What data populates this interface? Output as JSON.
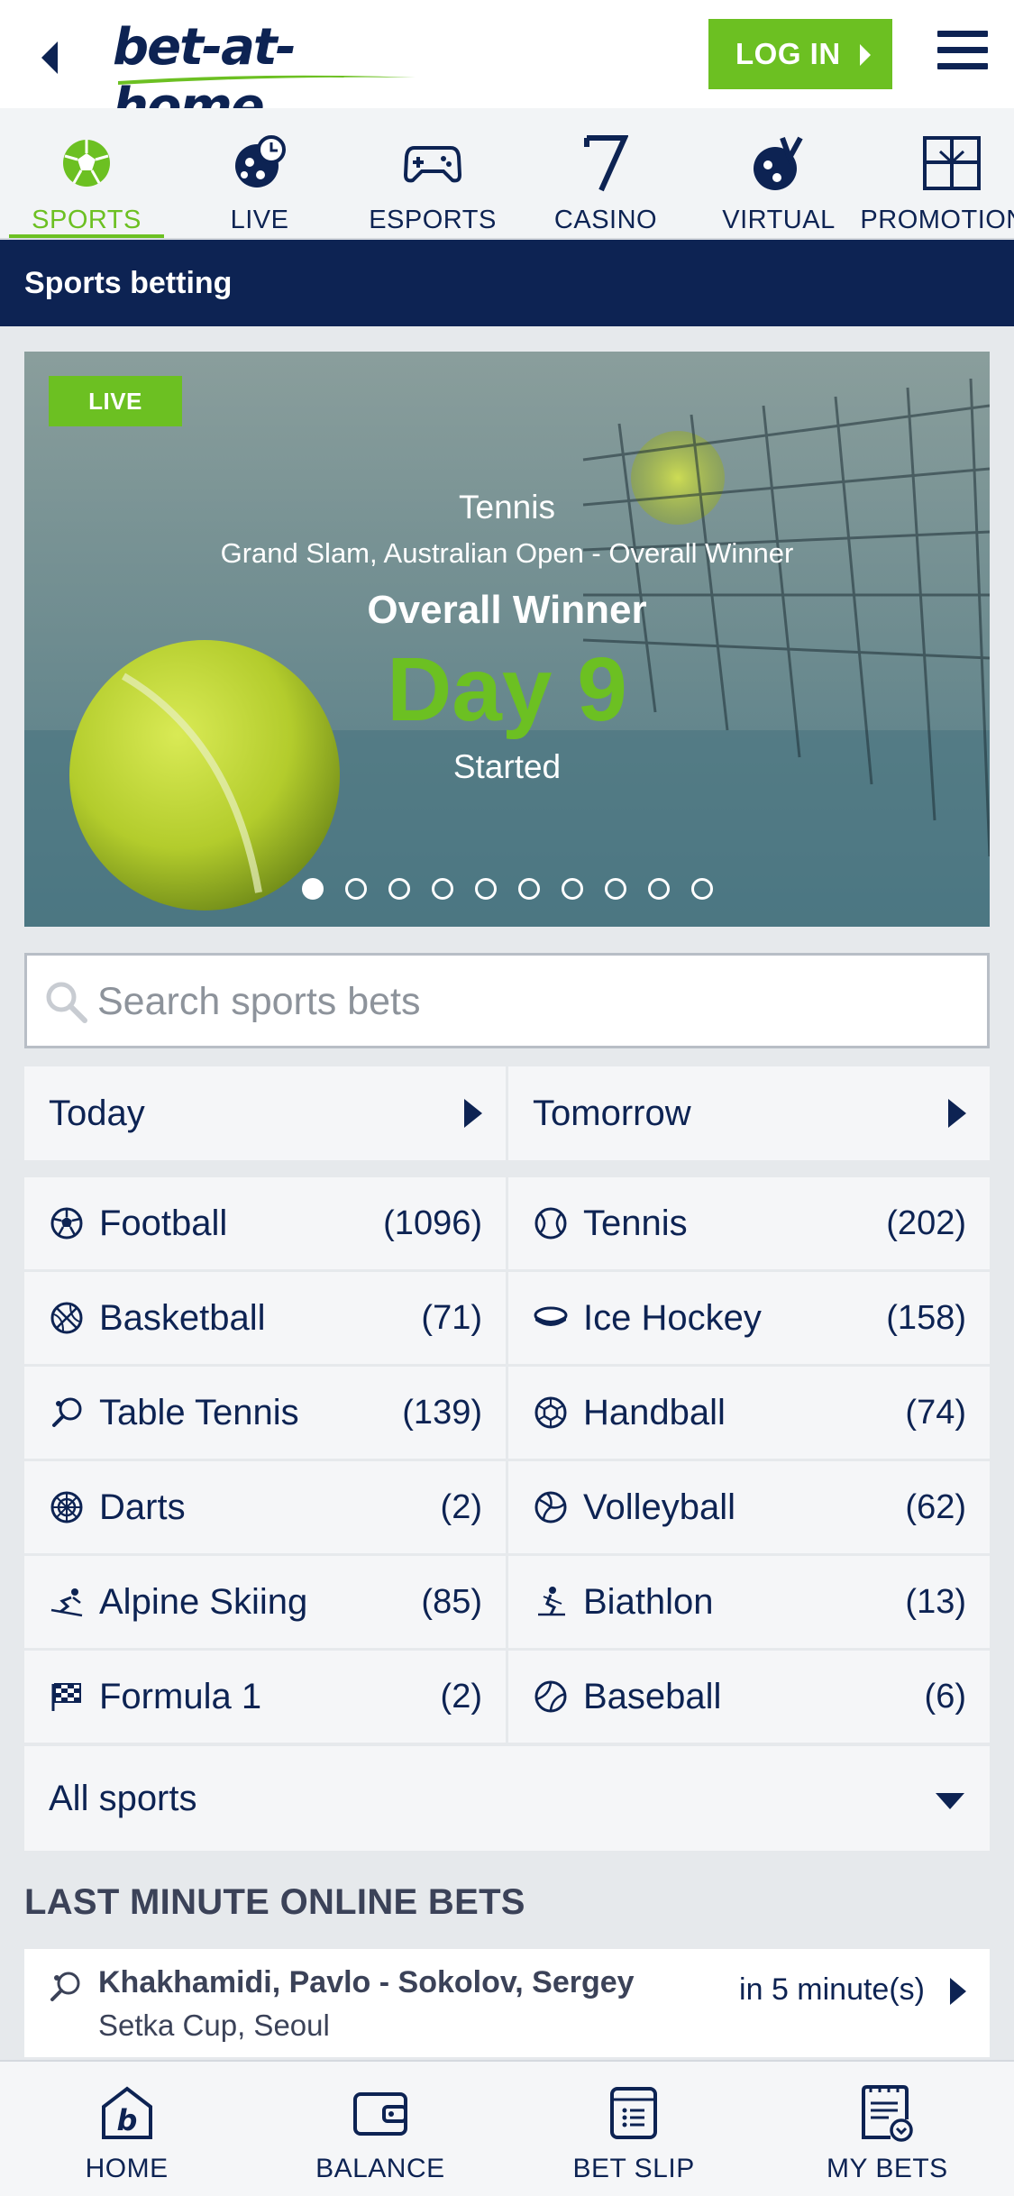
{
  "header": {
    "logo_text": "bet-at-home",
    "login_label": "LOG IN"
  },
  "nav": {
    "items": [
      {
        "label": "SPORTS",
        "icon": "football-icon",
        "active": true
      },
      {
        "label": "LIVE",
        "icon": "live-icon"
      },
      {
        "label": "ESPORTS",
        "icon": "gamepad-icon"
      },
      {
        "label": "CASINO",
        "icon": "seven-icon"
      },
      {
        "label": "VIRTUAL",
        "icon": "virtual-icon"
      },
      {
        "label": "PROMOTIONS",
        "icon": "promotions-icon"
      }
    ]
  },
  "titlebar": {
    "title": "Sports betting"
  },
  "banner": {
    "badge": "LIVE",
    "sport": "Tennis",
    "competition": "Grand Slam, Australian Open - Overall Winner",
    "market": "Overall Winner",
    "day": "Day 9",
    "status": "Started",
    "slides_total": 10,
    "slide_active": 1
  },
  "search": {
    "placeholder": "Search sports bets"
  },
  "days": [
    {
      "label": "Today"
    },
    {
      "label": "Tomorrow"
    }
  ],
  "sports": [
    {
      "name": "Football",
      "count": "(1096)",
      "icon": "football-icon"
    },
    {
      "name": "Tennis",
      "count": "(202)",
      "icon": "tennis-ball-icon"
    },
    {
      "name": "Basketball",
      "count": "(71)",
      "icon": "basketball-icon"
    },
    {
      "name": "Ice Hockey",
      "count": "(158)",
      "icon": "puck-icon"
    },
    {
      "name": "Table Tennis",
      "count": "(139)",
      "icon": "paddle-icon"
    },
    {
      "name": "Handball",
      "count": "(74)",
      "icon": "handball-icon"
    },
    {
      "name": "Darts",
      "count": "(2)",
      "icon": "dartboard-icon"
    },
    {
      "name": "Volleyball",
      "count": "(62)",
      "icon": "volleyball-icon"
    },
    {
      "name": "Alpine Skiing",
      "count": "(85)",
      "icon": "skier-icon"
    },
    {
      "name": "Biathlon",
      "count": "(13)",
      "icon": "biathlon-icon"
    },
    {
      "name": "Formula 1",
      "count": "(2)",
      "icon": "checkered-flag-icon"
    },
    {
      "name": "Baseball",
      "count": "(6)",
      "icon": "baseball-icon"
    }
  ],
  "all_sports": {
    "label": "All sports"
  },
  "last_minute": {
    "title": "LAST MINUTE ONLINE BETS",
    "items": [
      {
        "match": "Khakhamidi, Pavlo - Sokolov, Sergey",
        "competition": "Setka Cup, Seoul",
        "when": "in 5 minute(s)",
        "icon": "paddle-icon"
      }
    ]
  },
  "bottom_nav": [
    {
      "label": "HOME",
      "icon": "home-icon"
    },
    {
      "label": "BALANCE",
      "icon": "wallet-icon"
    },
    {
      "label": "BET SLIP",
      "icon": "betslip-icon"
    },
    {
      "label": "MY BETS",
      "icon": "mybets-icon"
    }
  ],
  "colors": {
    "brand_navy": "#0d2353",
    "brand_green": "#6cc022",
    "background": "#e6e9ec"
  }
}
